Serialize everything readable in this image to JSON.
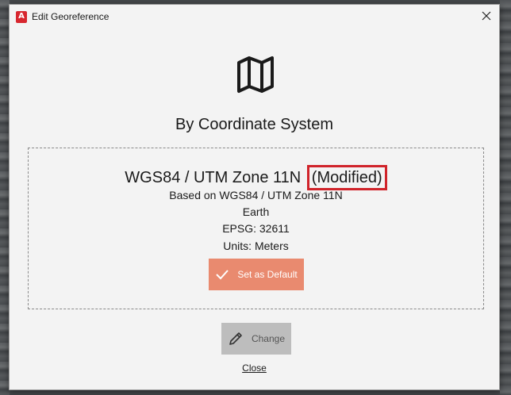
{
  "window": {
    "title": "Edit Georeference",
    "app_icon_letter": "A",
    "close_icon": "close-icon"
  },
  "main": {
    "icon": "map-icon",
    "heading": "By Coordinate System"
  },
  "crs": {
    "name": "WGS84 / UTM Zone 11N",
    "modified_label": "(Modified)",
    "based_on": "Based on WGS84 / UTM Zone 11N",
    "body": "Earth",
    "epsg": "EPSG: 32611",
    "units": "Units: Meters"
  },
  "buttons": {
    "set_default_label": "Set as Default",
    "change_label": "Change",
    "close_label": "Close"
  },
  "colors": {
    "accent": "#e98a6f",
    "highlight_border": "#d0232a",
    "disabled_button": "#bdbdbd",
    "app_icon": "#d7262e"
  }
}
